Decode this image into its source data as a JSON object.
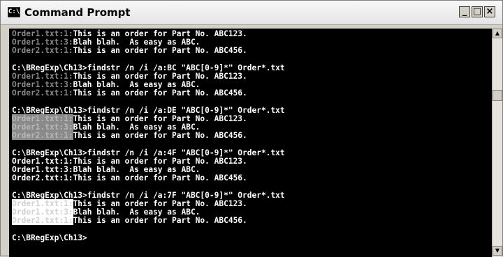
{
  "window": {
    "title": "Command Prompt",
    "icon_text": "C:\\",
    "minimize_label": "_",
    "maximize_label": "□",
    "close_label": "×"
  },
  "console": {
    "blocks": [
      {
        "prompt": "",
        "lines": [
          {
            "prefix": "Order1.txt:1:",
            "text": "This is an order for Part No. ABC123.",
            "style": "dim"
          },
          {
            "prefix": "Order1.txt:3:",
            "text": "Blah blah.  As easy as ABC.",
            "style": "dim"
          },
          {
            "prefix": "Order2.txt:1:",
            "text": "This is an order for Part No. ABC456.",
            "style": "dim"
          }
        ]
      },
      {
        "prompt": "C:\\BRegExp\\Ch13>findstr /n /i /a:BC \"ABC[0-9]*\" Order*.txt",
        "lines": [
          {
            "prefix": "Order1.txt:1:",
            "text": "This is an order for Part No. ABC123.",
            "style": "dim"
          },
          {
            "prefix": "Order1.txt:3:",
            "text": "Blah blah.  As easy as ABC.",
            "style": "dim"
          },
          {
            "prefix": "Order2.txt:1:",
            "text": "This is an order for Part No. ABC456.",
            "style": "dim"
          }
        ]
      },
      {
        "prompt": "C:\\BRegExp\\Ch13>findstr /n /i /a:DE \"ABC[0-9]*\" Order*.txt",
        "lines": [
          {
            "prefix": "Order1.txt:1:",
            "text": "This is an order for Part No. ABC123.",
            "style": "hl-dim"
          },
          {
            "prefix": "Order1.txt:3:",
            "text": "Blah blah.  As easy as ABC.",
            "style": "hl-dim"
          },
          {
            "prefix": "Order2.txt:1:",
            "text": "This is an order for Part No. ABC456.",
            "style": "hl-dim"
          }
        ]
      },
      {
        "prompt": "C:\\BRegExp\\Ch13>findstr /n /i /a:4F \"ABC[0-9]*\" Order*.txt",
        "lines": [
          {
            "prefix": "Order1.txt:1:",
            "text": "This is an order for Part No. ABC123.",
            "style": "white"
          },
          {
            "prefix": "Order1.txt:3:",
            "text": "Blah blah.  As easy as ABC.",
            "style": "white"
          },
          {
            "prefix": "Order2.txt:1:",
            "text": "This is an order for Part No. ABC456.",
            "style": "white"
          }
        ]
      },
      {
        "prompt": "C:\\BRegExp\\Ch13>findstr /n /i /a:7F \"ABC[0-9]*\" Order*.txt",
        "lines": [
          {
            "prefix": "Order1.txt:1:",
            "text": "This is an order for Part No. ABC123.",
            "style": "hl-bright"
          },
          {
            "prefix": "Order1.txt:3:",
            "text": "Blah blah.  As easy as ABC.",
            "style": "hl-bright"
          },
          {
            "prefix": "Order2.txt:1:",
            "text": "This is an order for Part No. ABC456.",
            "style": "hl-bright"
          }
        ]
      }
    ],
    "final_prompt": "C:\\BRegExp\\Ch13>"
  },
  "scrollbar": {
    "up_icon": "▲",
    "down_icon": "▼"
  },
  "colors": {
    "console_bg": "#000000",
    "text": "#ffffff",
    "dim": "#8a8a8a",
    "titlebar": "#ececec"
  }
}
